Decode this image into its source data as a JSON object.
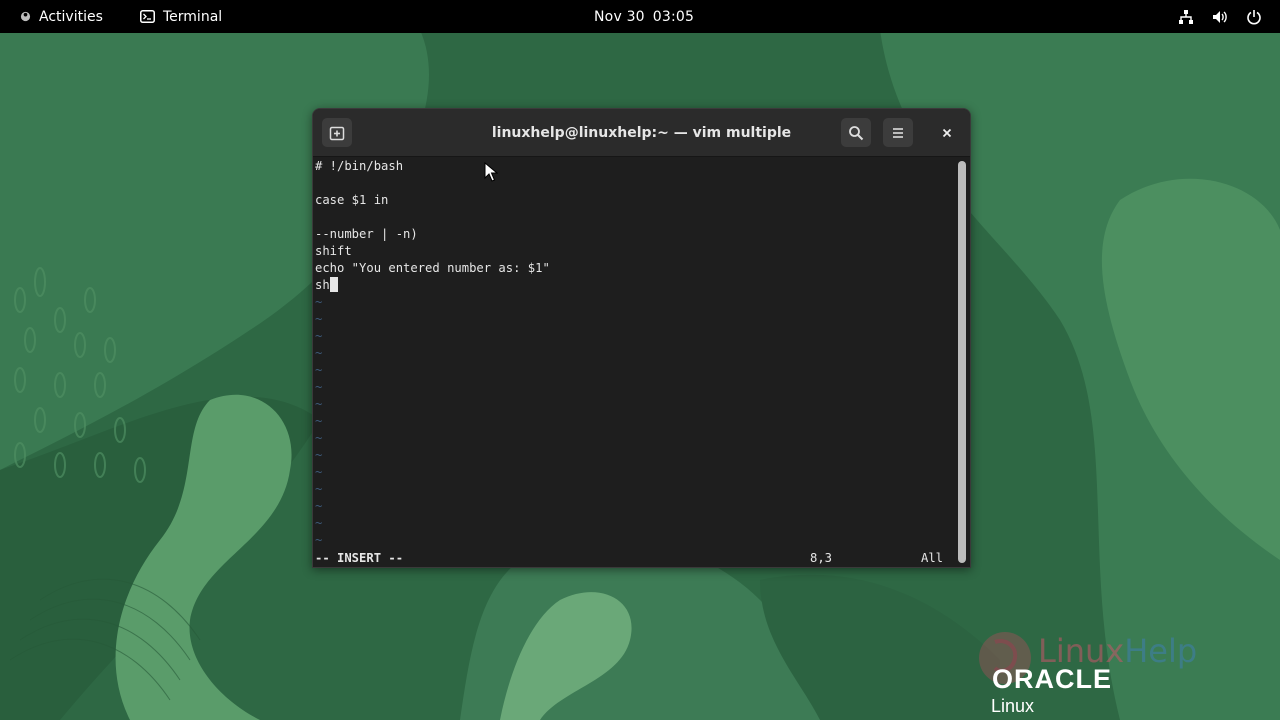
{
  "topbar": {
    "activities_label": "Activities",
    "app_name": "Terminal",
    "date": "Nov 30",
    "time": "03:05",
    "tray_icons": [
      "network-icon",
      "volume-icon",
      "power-icon"
    ]
  },
  "window": {
    "title": "linuxhelp@linuxhelp:~ — vim multiple",
    "buttons": [
      "new-tab-icon",
      "search-icon",
      "hamburger-menu-icon",
      "close-icon"
    ]
  },
  "editor": {
    "lines": [
      "# !/bin/bash",
      "",
      "case $1 in",
      "",
      "--number | -n)",
      "shift",
      "echo \"You entered number as: $1\"",
      "sh"
    ],
    "tilde_count": 15,
    "tilde_char": "~",
    "mode": "-- INSERT --",
    "position": "8,3",
    "scroll": "All"
  },
  "watermark": {
    "linux_part": "Linux",
    "help_part": "Help",
    "oracle": "ORACLE",
    "linux_label": "Linux"
  },
  "colors": {
    "wallpaper_base": "#2f6a45",
    "terminal_bg": "#1e1e1e",
    "titlebar_bg": "#2b2b2b",
    "tilde": "#3d5a7a"
  }
}
